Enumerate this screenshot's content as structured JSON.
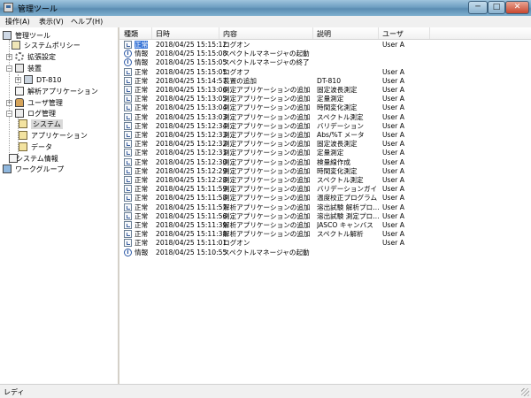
{
  "window": {
    "title": "管理ツール",
    "min_label": "─",
    "max_label": "□",
    "close_label": "✕"
  },
  "menu": [
    "操作(A)",
    "表示(V)",
    "ヘルプ(H)"
  ],
  "tree": [
    {
      "label": "管理ツール",
      "icon": "computer-icon"
    },
    {
      "label": "システムポリシー",
      "icon": "policy-icon"
    },
    {
      "label": "拡張設定",
      "icon": "gear-icon"
    },
    {
      "label": "装置",
      "icon": "device-icon"
    },
    {
      "label": "DT-810",
      "icon": "instrument-icon"
    },
    {
      "label": "解析アプリケーション",
      "icon": "app-icon"
    },
    {
      "label": "ユーザ管理",
      "icon": "users-icon"
    },
    {
      "label": "ログ管理",
      "icon": "log-icon"
    },
    {
      "label": "システム",
      "icon": "folder-icon"
    },
    {
      "label": "アプリケーション",
      "icon": "folder-icon"
    },
    {
      "label": "データ",
      "icon": "folder-icon"
    },
    {
      "label": "システム情報",
      "icon": "info-icon"
    },
    {
      "label": "ワークグループ",
      "icon": "workgroup-icon"
    }
  ],
  "columns": [
    "種類",
    "日時",
    "内容",
    "説明",
    "ユーザ"
  ],
  "rows": [
    {
      "type": "正常",
      "icon": "normal",
      "datetime": "2018/04/25 15:15:12",
      "content": "ログオン",
      "description": "",
      "user": "User A"
    },
    {
      "type": "情報",
      "icon": "info",
      "datetime": "2018/04/25 15:15:08",
      "content": "スペクトルマネージャの起動",
      "description": "",
      "user": ""
    },
    {
      "type": "情報",
      "icon": "info",
      "datetime": "2018/04/25 15:15:05",
      "content": "スペクトルマネージャの終了",
      "description": "",
      "user": ""
    },
    {
      "type": "正常",
      "icon": "normal",
      "datetime": "2018/04/25 15:15:05",
      "content": "ログオフ",
      "description": "",
      "user": "User A"
    },
    {
      "type": "正常",
      "icon": "normal",
      "datetime": "2018/04/25 15:14:57",
      "content": "装置の追加",
      "description": "DT-810",
      "user": "User A"
    },
    {
      "type": "正常",
      "icon": "normal",
      "datetime": "2018/04/25 15:13:06",
      "content": "測定アプリケーションの追加",
      "description": "固定波長測定",
      "user": "User A"
    },
    {
      "type": "正常",
      "icon": "normal",
      "datetime": "2018/04/25 15:13:05",
      "content": "測定アプリケーションの追加",
      "description": "定量測定",
      "user": "User A"
    },
    {
      "type": "正常",
      "icon": "normal",
      "datetime": "2018/04/25 15:13:04",
      "content": "測定アプリケーションの追加",
      "description": "時間変化測定",
      "user": "User A"
    },
    {
      "type": "正常",
      "icon": "normal",
      "datetime": "2018/04/25 15:13:03",
      "content": "測定アプリケーションの追加",
      "description": "スペクトル測定",
      "user": "User A"
    },
    {
      "type": "正常",
      "icon": "normal",
      "datetime": "2018/04/25 15:12:34",
      "content": "測定アプリケーションの追加",
      "description": "バリデーション",
      "user": "User A"
    },
    {
      "type": "正常",
      "icon": "normal",
      "datetime": "2018/04/25 15:12:33",
      "content": "測定アプリケーションの追加",
      "description": "Abs/%T メータ",
      "user": "User A"
    },
    {
      "type": "正常",
      "icon": "normal",
      "datetime": "2018/04/25 15:12:32",
      "content": "測定アプリケーションの追加",
      "description": "固定波長測定",
      "user": "User A"
    },
    {
      "type": "正常",
      "icon": "normal",
      "datetime": "2018/04/25 15:12:31",
      "content": "測定アプリケーションの追加",
      "description": "定量測定",
      "user": "User A"
    },
    {
      "type": "正常",
      "icon": "normal",
      "datetime": "2018/04/25 15:12:30",
      "content": "測定アプリケーションの追加",
      "description": "検量線作成",
      "user": "User A"
    },
    {
      "type": "正常",
      "icon": "normal",
      "datetime": "2018/04/25 15:12:29",
      "content": "測定アプリケーションの追加",
      "description": "時間変化測定",
      "user": "User A"
    },
    {
      "type": "正常",
      "icon": "normal",
      "datetime": "2018/04/25 15:12:28",
      "content": "測定アプリケーションの追加",
      "description": "スペクトル測定",
      "user": "User A"
    },
    {
      "type": "正常",
      "icon": "normal",
      "datetime": "2018/04/25 15:11:59",
      "content": "測定アプリケーションの追加",
      "description": "バリデーションガイド",
      "user": "User A"
    },
    {
      "type": "正常",
      "icon": "normal",
      "datetime": "2018/04/25 15:11:58",
      "content": "測定アプリケーションの追加",
      "description": "温度校正プログラム",
      "user": "User A"
    },
    {
      "type": "正常",
      "icon": "normal",
      "datetime": "2018/04/25 15:11:57",
      "content": "解析アプリケーションの追加",
      "description": "溶出試験 解析プロ…",
      "user": "User A"
    },
    {
      "type": "正常",
      "icon": "normal",
      "datetime": "2018/04/25 15:11:56",
      "content": "測定アプリケーションの追加",
      "description": "溶出試験 測定プロ…",
      "user": "User A"
    },
    {
      "type": "正常",
      "icon": "normal",
      "datetime": "2018/04/25 15:11:39",
      "content": "解析アプリケーションの追加",
      "description": "JASCO キャンバス",
      "user": "User A"
    },
    {
      "type": "正常",
      "icon": "normal",
      "datetime": "2018/04/25 15:11:38",
      "content": "解析アプリケーションの追加",
      "description": "スペクトル解析",
      "user": "User A"
    },
    {
      "type": "正常",
      "icon": "normal",
      "datetime": "2018/04/25 15:11:01",
      "content": "ログオン",
      "description": "",
      "user": "User A"
    },
    {
      "type": "情報",
      "icon": "info",
      "datetime": "2018/04/25 15:10:55",
      "content": "スペクトルマネージャの起動",
      "description": "",
      "user": ""
    }
  ],
  "status": {
    "text": "レディ"
  }
}
